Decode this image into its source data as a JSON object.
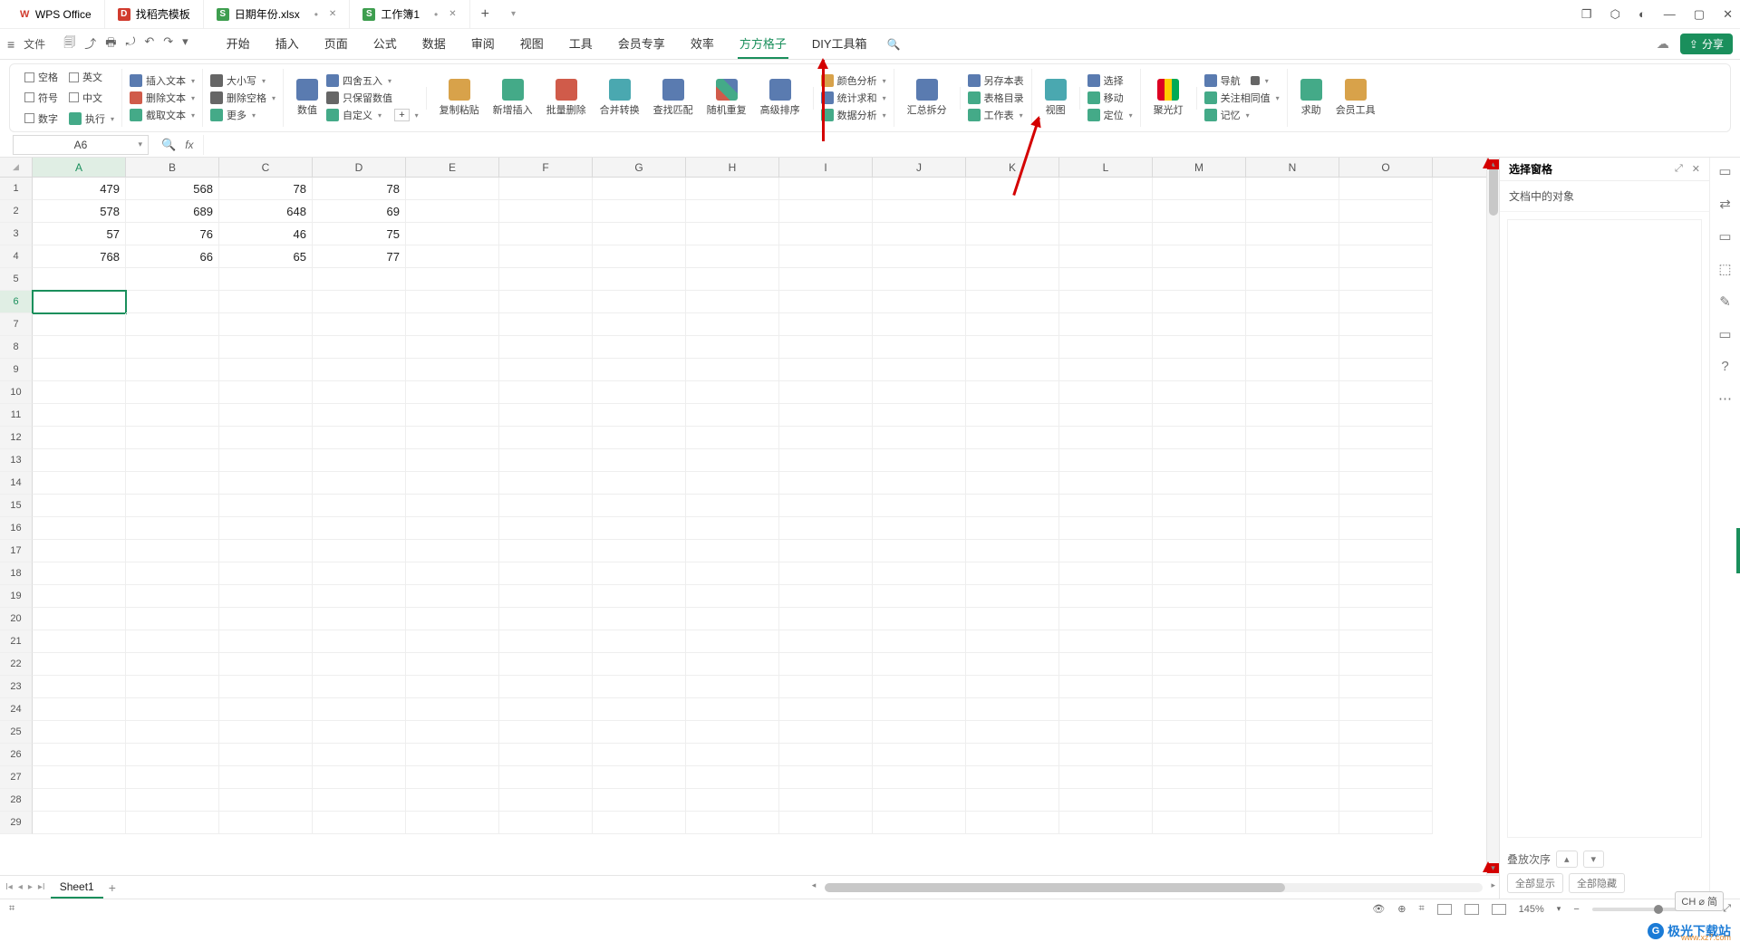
{
  "titlebar": {
    "app": "WPS Office",
    "tabs": [
      {
        "icon": "red",
        "label": "找稻壳模板"
      },
      {
        "icon": "green",
        "label": "日期年份.xlsx",
        "closeable": true
      },
      {
        "icon": "green",
        "label": "工作簿1",
        "dirty": true,
        "closeable": true
      }
    ],
    "window_icons": [
      "❐",
      "⬡",
      "◐",
      "—",
      "▢",
      "✕"
    ]
  },
  "menubar": {
    "file": "文件",
    "quick": [
      "🗐",
      "⤴",
      "🖶",
      "⤾",
      "↶",
      "↷",
      "▾"
    ],
    "tabs": [
      "开始",
      "插入",
      "页面",
      "公式",
      "数据",
      "审阅",
      "视图",
      "工具",
      "会员专享",
      "效率",
      "方方格子",
      "DIY工具箱"
    ],
    "active_tab": "方方格子",
    "search_icon": "🔍",
    "cloud_icon": "☁",
    "share": "分享"
  },
  "ribbon": {
    "checks": [
      {
        "label": "空格"
      },
      {
        "label": "英文"
      },
      {
        "label": "符号"
      },
      {
        "label": "中文"
      },
      {
        "label": "数字"
      },
      {
        "label": "执行",
        "caret": true
      }
    ],
    "group_text": [
      {
        "label": "插入文本",
        "caret": true
      },
      {
        "label": "删除文本",
        "caret": true
      },
      {
        "label": "截取文本",
        "caret": true
      }
    ],
    "group_case": [
      {
        "label": "大小写",
        "caret": true
      },
      {
        "label": "删除空格",
        "caret": true
      },
      {
        "label": "更多",
        "caret": true
      }
    ],
    "group_num": {
      "big": "数值",
      "items": [
        {
          "label": "四舍五入",
          "caret": true
        },
        {
          "label": "只保留数值"
        },
        {
          "label": "自定义",
          "caret": true
        },
        {
          "label_plus": "+"
        }
      ]
    },
    "bigs": [
      {
        "label": "复制粘贴",
        "caret": true,
        "cls": "orn"
      },
      {
        "label": "新增插入",
        "caret": true,
        "cls": "grn"
      },
      {
        "label": "批量删除",
        "caret": true,
        "cls": "red"
      },
      {
        "label": "合并转换",
        "caret": true,
        "cls": "cyan"
      },
      {
        "label": "查找匹配",
        "caret": true,
        "cls": ""
      },
      {
        "label": "随机重复",
        "caret": true,
        "cls": "mix"
      },
      {
        "label": "高级排序",
        "caret": true,
        "cls": ""
      }
    ],
    "group_stat": [
      {
        "label": "颜色分析",
        "caret": true
      },
      {
        "label": "统计求和",
        "caret": true
      },
      {
        "label": "数据分析",
        "caret": true
      }
    ],
    "big_split": {
      "label": "汇总拆分",
      "caret": true
    },
    "group_sheet": [
      {
        "label": "另存本表"
      },
      {
        "label": "表格目录"
      },
      {
        "label": "工作表",
        "caret": true
      }
    ],
    "big_view": {
      "label": "视图",
      "caret": true
    },
    "group_nav": [
      {
        "label": "选择"
      },
      {
        "label": "移动"
      },
      {
        "label": "定位",
        "caret": true
      }
    ],
    "big_light": {
      "label": "聚光灯",
      "caret": true,
      "cls": "rainbow"
    },
    "group_watch": [
      {
        "label": "导航",
        "caret": true
      },
      {
        "label": "关注相同值",
        "caret": true
      },
      {
        "label": "记忆",
        "caret": true
      }
    ],
    "big_help": {
      "label": "求助"
    },
    "big_member": {
      "label": "会员工具"
    }
  },
  "formula": {
    "name_box": "A6",
    "fx": "fx"
  },
  "grid": {
    "columns": [
      "A",
      "B",
      "C",
      "D",
      "E",
      "F",
      "G",
      "H",
      "I",
      "J",
      "K",
      "L",
      "M",
      "N",
      "O"
    ],
    "selected_col": "A",
    "selected_row": 6,
    "row_count": 29,
    "data": {
      "1": {
        "A": "479",
        "B": "568",
        "C": "78",
        "D": "78"
      },
      "2": {
        "A": "578",
        "B": "689",
        "C": "648",
        "D": "69"
      },
      "3": {
        "A": "57",
        "B": "76",
        "C": "46",
        "D": "75"
      },
      "4": {
        "A": "768",
        "B": "66",
        "C": "65",
        "D": "77"
      }
    }
  },
  "sheet_tabs": {
    "nav": [
      "I◂",
      "◂",
      "▸",
      "▸I"
    ],
    "active": "Sheet1",
    "add": "+"
  },
  "right_panel": {
    "title": "选择窗格",
    "subtitle": "文档中的对象",
    "order_label": "叠放次序",
    "btn_show_all": "全部显示",
    "btn_hide_all": "全部隐藏",
    "icons": [
      "⤢",
      "✕"
    ],
    "collapse": "—"
  },
  "side_rail": [
    "▭",
    "⇄",
    "▭",
    "⬚",
    "✎",
    "▭",
    "?",
    "⋯"
  ],
  "ime": "CH ⌀ 简",
  "watermark": {
    "main": "极光下载站",
    "sub": "www.xz7.com"
  },
  "status": {
    "left_icon": "⌗",
    "icons": [
      "👁",
      "⊕",
      "⌗",
      "▭",
      "▭",
      "▭"
    ],
    "zoom": "145%",
    "minus": "−",
    "plus": "+",
    "expand": "⤢"
  }
}
